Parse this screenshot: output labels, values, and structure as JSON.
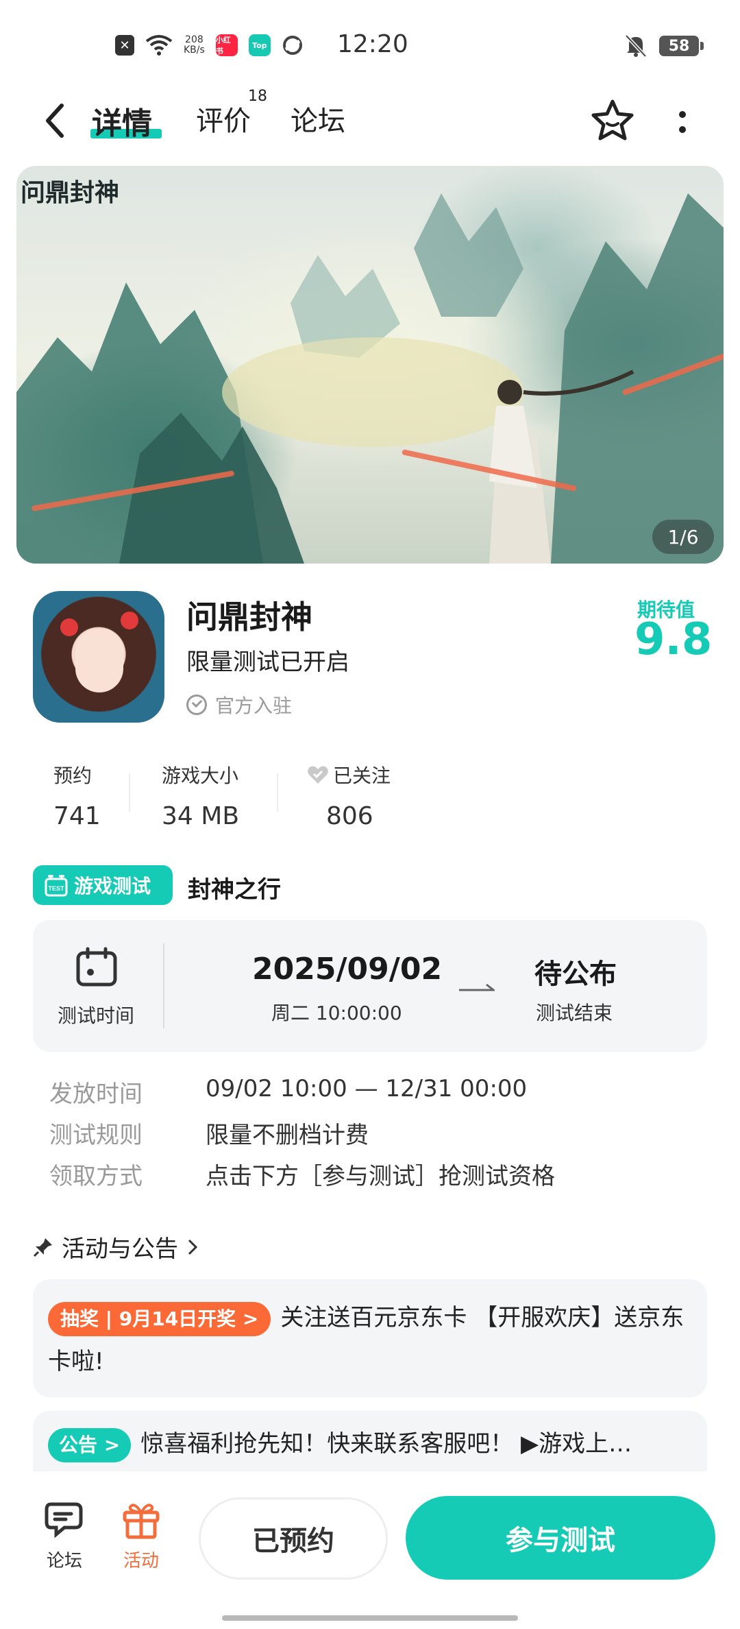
{
  "status_bar": {
    "speed_value": "208",
    "speed_unit": "KB/s",
    "app_label_1": "小红书",
    "app_label_2": "Top",
    "time": "12:20",
    "battery": "58"
  },
  "header": {
    "tabs": [
      {
        "label": "详情",
        "active": true
      },
      {
        "label": "评价",
        "badge": "18"
      },
      {
        "label": "论坛"
      }
    ]
  },
  "banner": {
    "logo_text": "问鼎封神",
    "counter": "1/6"
  },
  "app": {
    "name": "问鼎封神",
    "subtitle": "限量测试已开启",
    "official": "官方入驻",
    "expect_label": "期待值",
    "expect_value": "9.8"
  },
  "stats": [
    {
      "label": "预约",
      "value": "741"
    },
    {
      "label": "游戏大小",
      "value": "34 MB"
    },
    {
      "label": "已关注",
      "value": "806"
    }
  ],
  "test": {
    "tag": "游戏测试",
    "title": "封神之行",
    "time_label": "测试时间",
    "start_date": "2025/09/02",
    "start_time": "周二  10:00:00",
    "end_date": "待公布",
    "end_label": "测试结束",
    "rows": [
      {
        "key": "发放时间",
        "value": "09/02 10:00 — 12/31 00:00"
      },
      {
        "key": "测试规则",
        "value": "限量不删档计费"
      },
      {
        "key": "领取方式",
        "value": "点击下方［参与测试］抢测试资格"
      }
    ]
  },
  "activities": {
    "heading": "活动与公告",
    "item1_badge": "抽奖 | 9月14日开奖 >",
    "item1_text": "关注送百元京东卡 【开服欢庆】送京东卡啦!",
    "item2_badge": "公告 >",
    "item2_text": "惊喜福利抢先知！快来联系客服吧！ ▶游戏上…"
  },
  "bottom_bar": {
    "forum_label": "论坛",
    "activity_label": "活动",
    "reserved_label": "已预约",
    "join_label": "参与测试"
  },
  "colors": {
    "accent": "#15cbb5",
    "orange": "#fb6a36",
    "card_bg": "#f4f5f7"
  }
}
